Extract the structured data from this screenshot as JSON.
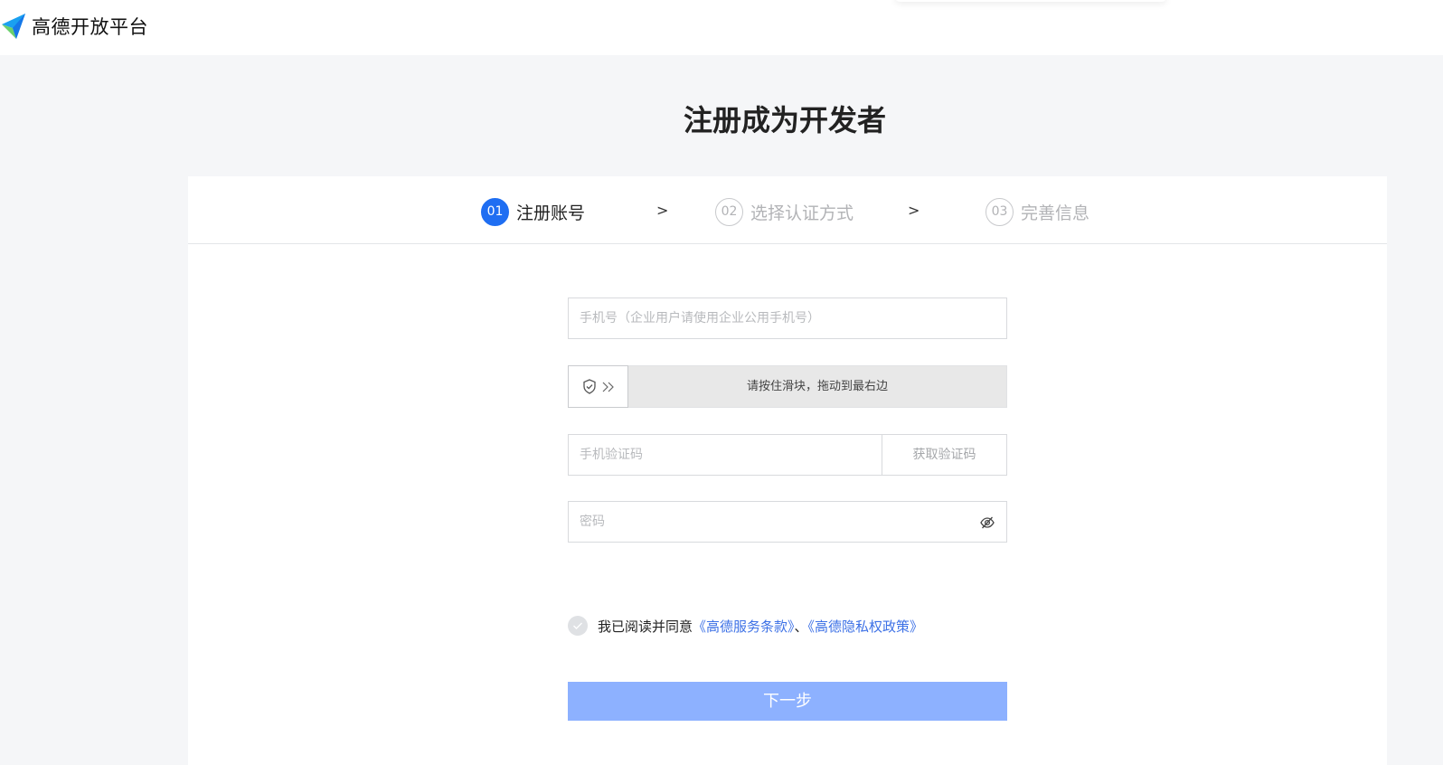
{
  "brand": {
    "name": "高德开放平台",
    "accent": "#1f6ef2"
  },
  "page_title": "注册成为开发者",
  "steps": [
    {
      "num": "01",
      "label": "注册账号",
      "active": true
    },
    {
      "num": "02",
      "label": "选择认证方式",
      "active": false
    },
    {
      "num": "03",
      "label": "完善信息",
      "active": false
    }
  ],
  "step_separator": ">",
  "form": {
    "phone_placeholder": "手机号（企业用户请使用企业公用手机号）",
    "slider_text": "请按住滑块，拖动到最右边",
    "sms_placeholder": "手机验证码",
    "get_code_label": "获取验证码",
    "password_placeholder": "密码"
  },
  "agreement": {
    "prefix": "我已阅读并同意",
    "terms": "《高德服务条款》",
    "separator": "、",
    "privacy": "《高德隐私权政策》"
  },
  "next_button": "下一步",
  "icons": {
    "logo": "amap-arrow-logo",
    "slider_shield": "shield-check-icon",
    "slider_arrows": "double-chevron-right-icon",
    "password_toggle": "eye-off-icon",
    "agree_check": "check-icon"
  }
}
